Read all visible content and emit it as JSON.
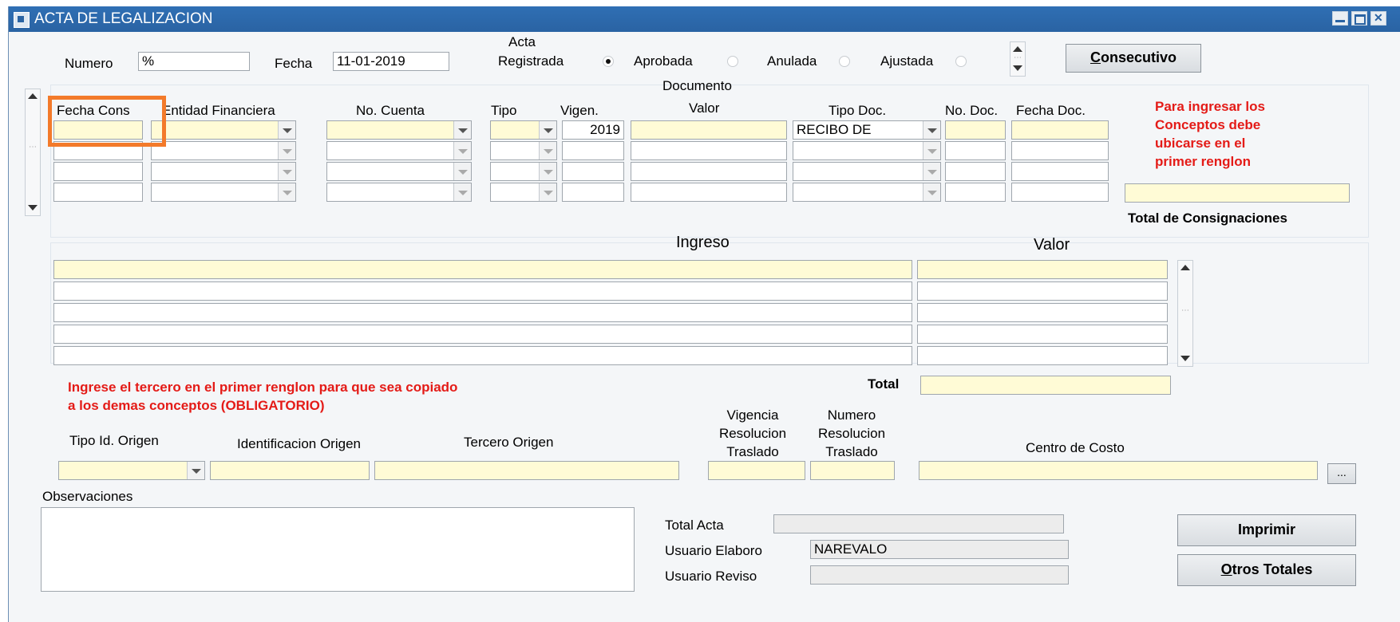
{
  "window": {
    "title": "ACTA DE LEGALIZACION"
  },
  "header": {
    "numero_label": "Numero",
    "numero_value": "%",
    "fecha_label": "Fecha",
    "fecha_value": "11-01-2019",
    "acta_label": "Acta",
    "status_options": [
      "Registrada",
      "Aprobada",
      "Anulada",
      "Ajustada"
    ],
    "selected_status": "Registrada",
    "consecutivo_label": "onsecutivo",
    "consecutivo_mnemonic": "C"
  },
  "documento": {
    "section_label": "Documento",
    "columns": [
      "Fecha Cons",
      "Entidad Financiera",
      "No. Cuenta",
      "Tipo",
      "Vigen.",
      "Valor",
      "Tipo Doc.",
      "No. Doc.",
      "Fecha Doc."
    ],
    "first_row": {
      "vigencia": "2019",
      "tipo_doc": "RECIBO DE"
    },
    "note_lines": [
      "Para ingresar los",
      "Conceptos debe",
      "ubicarse en el",
      "primer renglon"
    ],
    "total_label": "Total de Consignaciones"
  },
  "ingreso": {
    "col_ingreso": "Ingreso",
    "col_valor": "Valor",
    "total_label": "Total"
  },
  "tercero": {
    "note_lines": [
      "Ingrese el tercero en el primer renglon para que sea copiado",
      "a los demas conceptos (OBLIGATORIO)"
    ],
    "tipo_id_label": "Tipo Id. Origen",
    "identificacion_label": "Identificacion Origen",
    "tercero_label": "Tercero Origen",
    "vigencia_lines": [
      "Vigencia",
      "Resolucion",
      "Traslado"
    ],
    "numero_lines": [
      "Numero",
      "Resolucion",
      "Traslado"
    ],
    "centro_costo_label": "Centro de Costo",
    "ellipsis_label": "..."
  },
  "footer": {
    "observaciones_label": "Observaciones",
    "total_acta_label": "Total Acta",
    "usuario_elaboro_label": "Usuario Elaboro",
    "usuario_elaboro_value": "NAREVALO",
    "usuario_reviso_label": "Usuario Reviso",
    "imprimir_label": "Imprimir",
    "otros_totales_label": "tros Totales",
    "otros_totales_mnemonic": "O"
  },
  "colors": {
    "title_bar": "#2a63a3",
    "required_field": "#fffbd6",
    "warning_text": "#e41b17",
    "highlight_box": "#f37a2a"
  }
}
